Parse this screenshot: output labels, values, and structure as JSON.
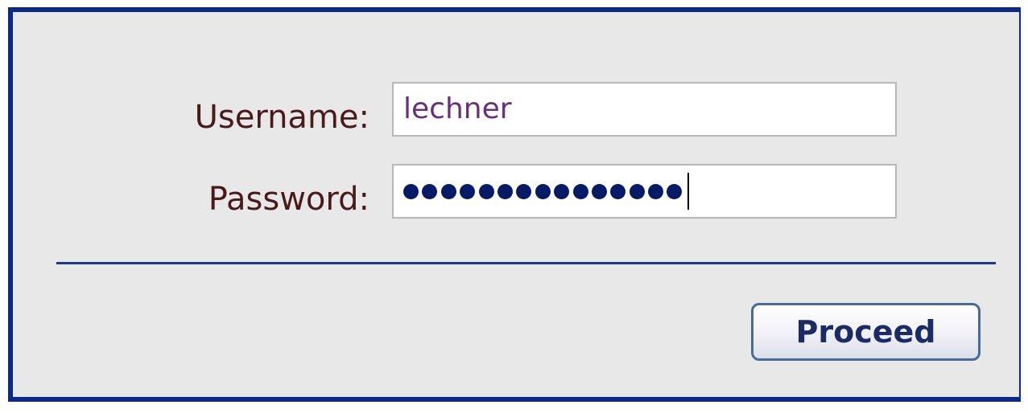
{
  "login_form": {
    "username_label": "Username:",
    "username_value": "lechner",
    "password_label": "Password:",
    "password_masked_length": 15,
    "proceed_label": "Proceed"
  },
  "colors": {
    "border": "#0a2a86",
    "panel_background": "#e8e8e8",
    "label_text": "#4a1a1a",
    "input_text": "#6a2f7a",
    "password_dots": "#061a66",
    "button_text": "#1a2b66"
  }
}
